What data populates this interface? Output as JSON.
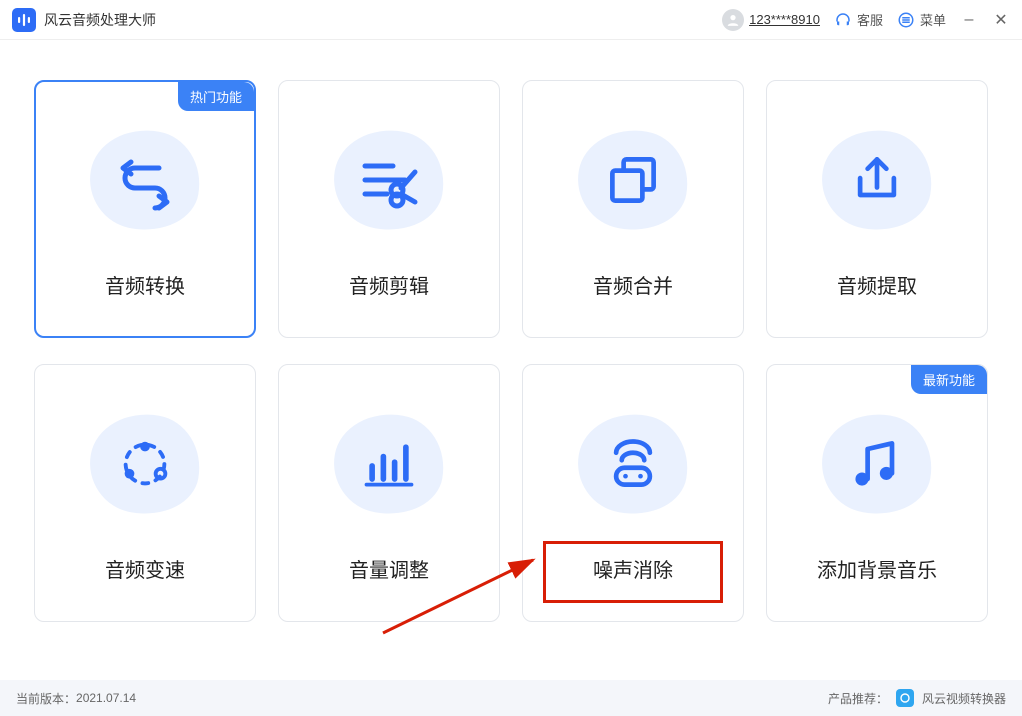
{
  "titlebar": {
    "app_name": "风云音频处理大师",
    "user_id": "123****8910",
    "support_label": "客服",
    "menu_label": "菜单"
  },
  "badges": {
    "hot": "热门功能",
    "new": "最新功能"
  },
  "cards": [
    {
      "label": "音频转换"
    },
    {
      "label": "音频剪辑"
    },
    {
      "label": "音频合并"
    },
    {
      "label": "音频提取"
    },
    {
      "label": "音频变速"
    },
    {
      "label": "音量调整"
    },
    {
      "label": "噪声消除"
    },
    {
      "label": "添加背景音乐"
    }
  ],
  "footer": {
    "version_label": "当前版本：",
    "version": "2021.07.14",
    "recommend_label": "产品推荐：",
    "recommend_app": "风云视频转换器"
  }
}
